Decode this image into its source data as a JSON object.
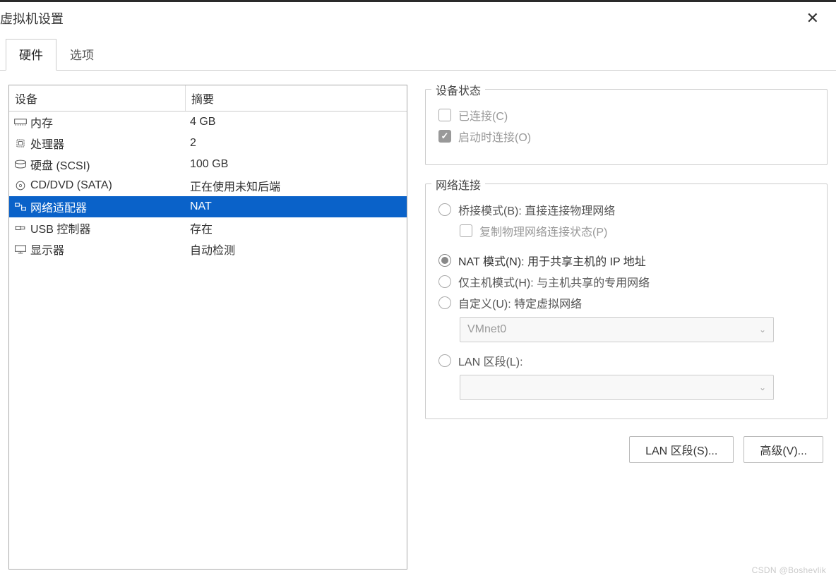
{
  "titlebar": {
    "title": "虚拟机设置"
  },
  "tabs": {
    "hardware": "硬件",
    "options": "选项"
  },
  "device_list": {
    "header_device": "设备",
    "header_summary": "摘要",
    "rows": [
      {
        "icon": "memory",
        "name": "内存",
        "summary": "4 GB"
      },
      {
        "icon": "cpu",
        "name": "处理器",
        "summary": "2"
      },
      {
        "icon": "disk",
        "name": "硬盘 (SCSI)",
        "summary": "100 GB"
      },
      {
        "icon": "cd",
        "name": "CD/DVD (SATA)",
        "summary": "正在使用未知后端"
      },
      {
        "icon": "net",
        "name": "网络适配器",
        "summary": "NAT"
      },
      {
        "icon": "usb",
        "name": "USB 控制器",
        "summary": "存在"
      },
      {
        "icon": "display",
        "name": "显示器",
        "summary": "自动检测"
      }
    ],
    "selected_index": 4
  },
  "device_status": {
    "title": "设备状态",
    "connected_label": "已连接(C)",
    "connect_at_power_label": "启动时连接(O)"
  },
  "network": {
    "title": "网络连接",
    "bridged_label": "桥接模式(B): 直接连接物理网络",
    "replicate_label": "复制物理网络连接状态(P)",
    "nat_label": "NAT 模式(N): 用于共享主机的 IP 地址",
    "hostonly_label": "仅主机模式(H): 与主机共享的专用网络",
    "custom_label": "自定义(U): 特定虚拟网络",
    "custom_value": "VMnet0",
    "lan_segment_label": "LAN 区段(L):",
    "lan_segment_value": ""
  },
  "buttons": {
    "lan_segments": "LAN 区段(S)...",
    "advanced": "高级(V)..."
  },
  "watermark": "CSDN @Boshevlik"
}
